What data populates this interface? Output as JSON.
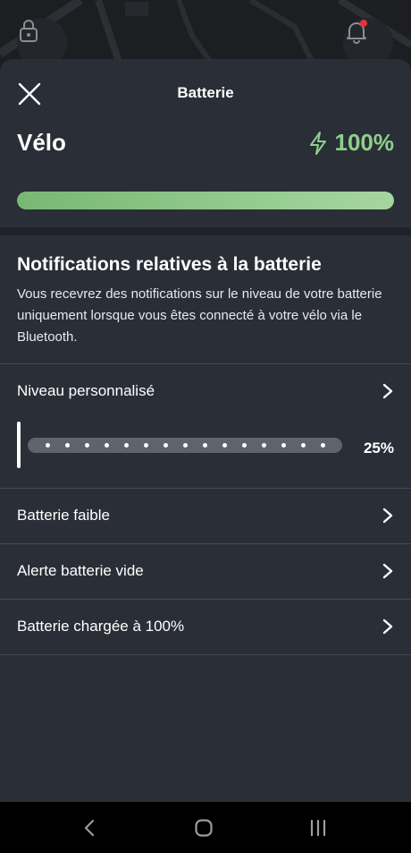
{
  "header": {
    "title": "Batterie"
  },
  "battery": {
    "bike_label": "Vélo",
    "level_text": "100%",
    "level_fraction": 1.0
  },
  "notifications": {
    "title": "Notifications relatives à la batterie",
    "description": "Vous recevrez des notifications sur le niveau de votre batterie uniquement lorsque vous êtes connecté à votre vélo via le Bluetooth."
  },
  "custom_level": {
    "label": "Niveau personnalisé",
    "value_text": "25%",
    "slider_dots": 15
  },
  "list": [
    {
      "label": "Batterie faible"
    },
    {
      "label": "Alerte batterie vide"
    },
    {
      "label": "Batterie chargée à 100%"
    }
  ],
  "colors": {
    "accent_green": "#8fcf8b",
    "sheet_bg": "#2a2e37",
    "notification_dot": "#e0343a"
  },
  "icons": {
    "close": "close-icon",
    "bolt": "lightning-icon",
    "chevron": "chevron-right-icon",
    "lock": "lock-icon",
    "bell": "bell-icon"
  }
}
